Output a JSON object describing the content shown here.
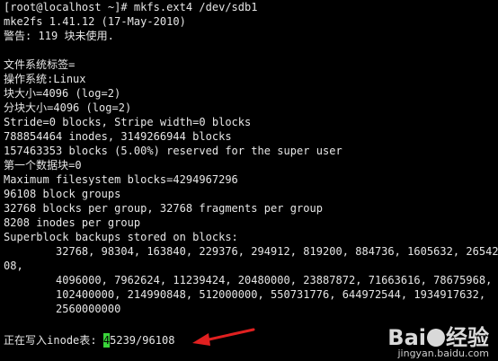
{
  "terminal": {
    "lines": [
      "[root@localhost ~]# mkfs.ext4 /dev/sdb1",
      "mke2fs 1.41.12 (17-May-2010)",
      "警告: 119 块未使用.",
      "",
      "文件系统标签=",
      "操作系统:Linux",
      "块大小=4096 (log=2)",
      "分块大小=4096 (log=2)",
      "Stride=0 blocks, Stripe width=0 blocks",
      "788854464 inodes, 3149266944 blocks",
      "157463353 blocks (5.00%) reserved for the super user",
      "第一个数据块=0",
      "Maximum filesystem blocks=4294967296",
      "96108 block groups",
      "32768 blocks per group, 32768 fragments per group",
      "8208 inodes per group",
      "Superblock backups stored on blocks:",
      "        32768, 98304, 163840, 229376, 294912, 819200, 884736, 1605632, 26542",
      "08,",
      "        4096000, 7962624, 11239424, 20480000, 23887872, 71663616, 78675968,",
      "        102400000, 214990848, 512000000, 550731776, 644972544, 1934917632,",
      "        2560000000",
      ""
    ],
    "progress_prefix": "正在写入inode表: ",
    "progress_cursor_char": "4",
    "progress_rest": "5239/96108"
  },
  "watermark": {
    "logo_left": "Bai",
    "logo_right": "经验",
    "url": "jingyan.baidu.com"
  },
  "colors": {
    "background": "#000000",
    "text": "#e6e6e6",
    "cursor": "#3ad43a",
    "arrow": "#e02020"
  }
}
